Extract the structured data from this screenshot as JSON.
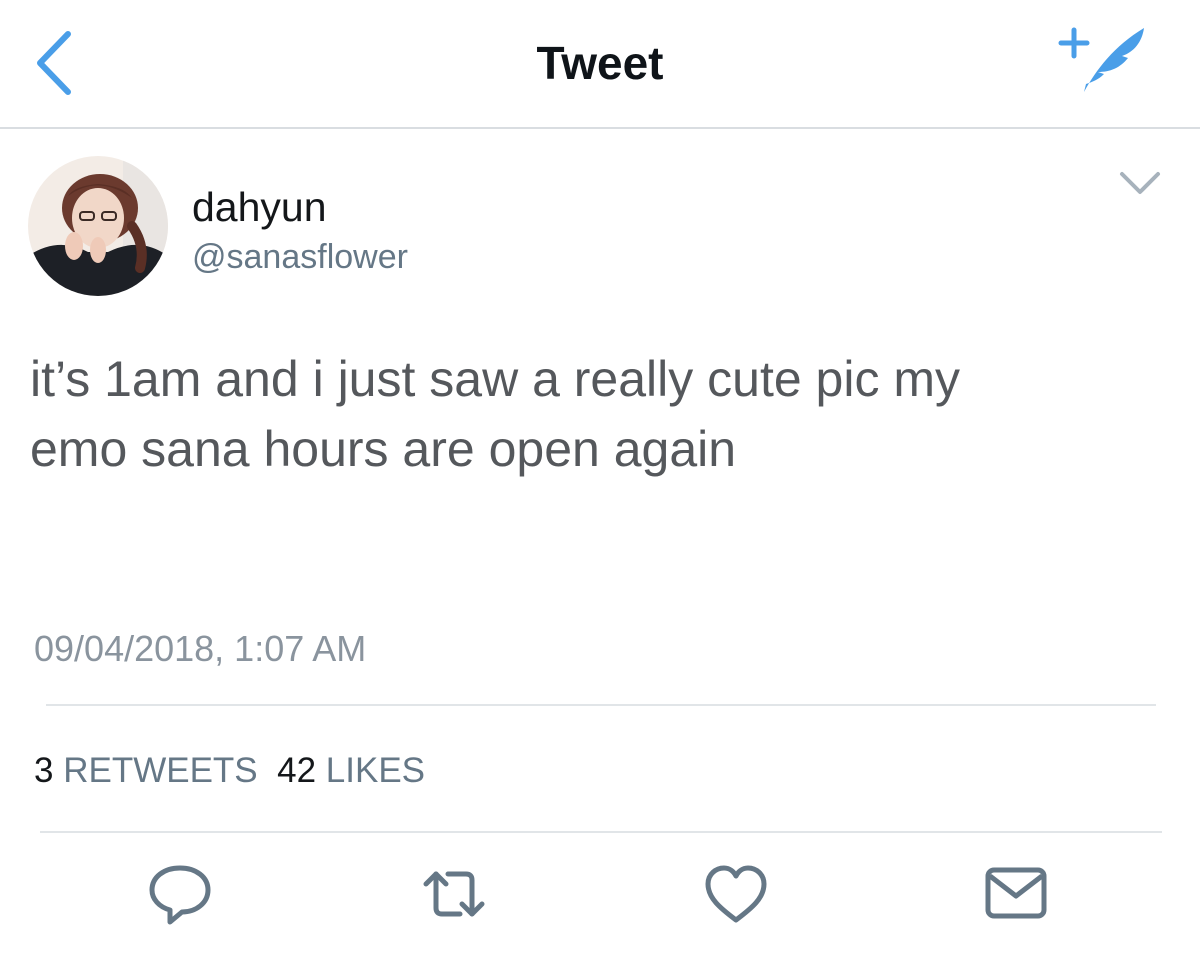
{
  "header": {
    "title": "Tweet",
    "back_icon": "chevron-left-icon",
    "compose_icon": "compose-tweet-icon",
    "accent": "#4a9ee8"
  },
  "tweet": {
    "author_name": "dahyun",
    "author_handle": "@sanasflower",
    "text_line1": "it’s 1am and i just saw a really cute pic my",
    "text_line2": "emo sana hours are open again",
    "timestamp": "09/04/2018, 1:07 AM"
  },
  "stats": {
    "retweets_count": "3",
    "retweets_label": "RETWEETS",
    "likes_count": "42",
    "likes_label": "LIKES"
  },
  "actions": {
    "reply_icon": "reply-icon",
    "retweet_icon": "retweet-icon",
    "like_icon": "heart-icon",
    "dm_icon": "envelope-icon"
  }
}
